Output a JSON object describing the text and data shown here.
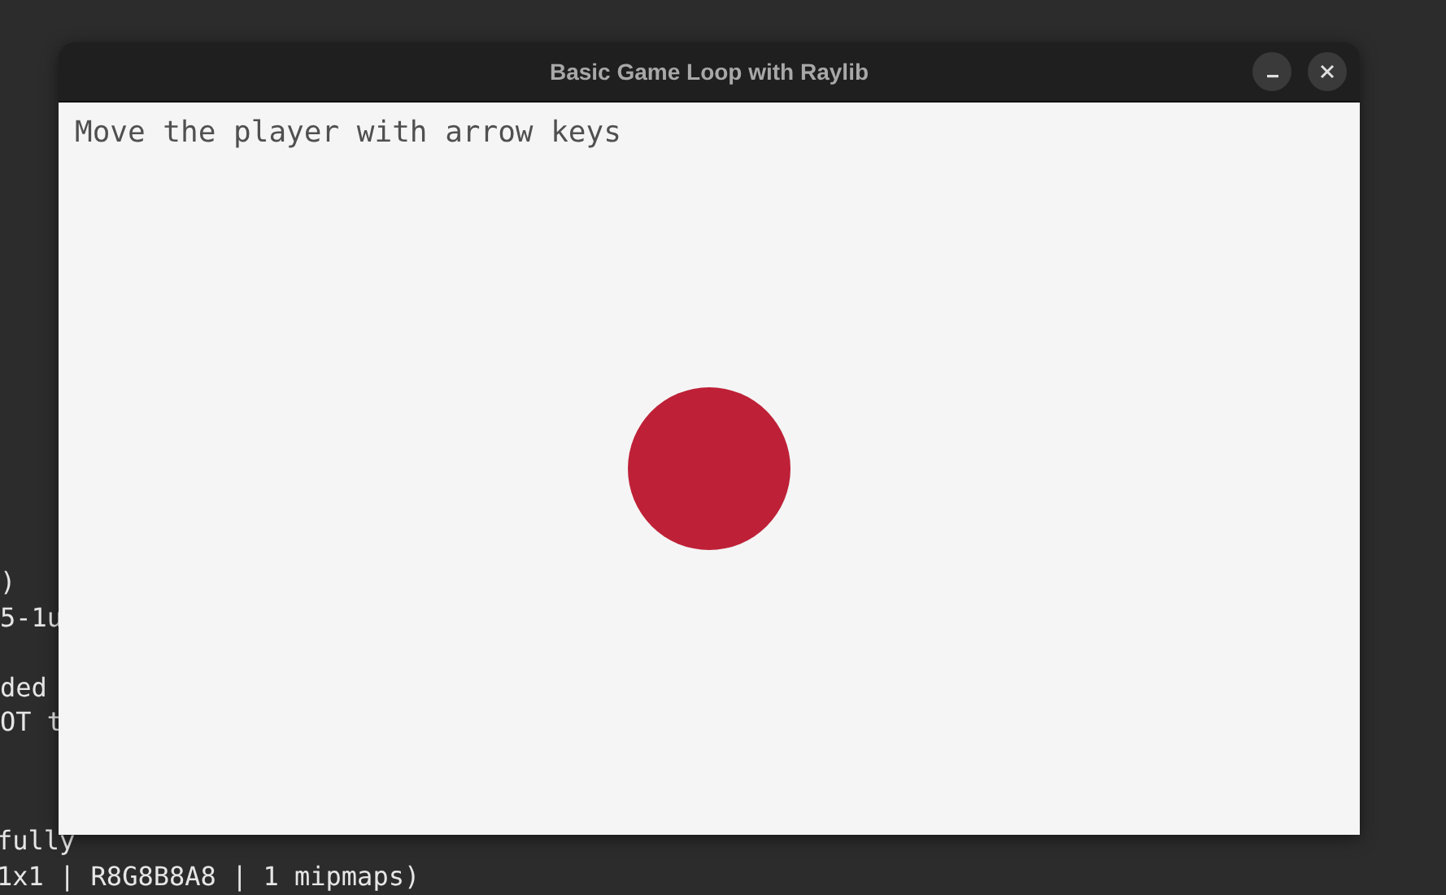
{
  "terminal": {
    "lines_middle": [
      ")",
      "5-1u",
      "ded",
      "OT t"
    ],
    "lines_bottom": [
      "fully",
      "1x1 | R8G8B8A8 | 1 mipmaps)"
    ]
  },
  "window": {
    "title": "Basic Game Loop with Raylib",
    "buttons": [
      {
        "kind": "minimize"
      },
      {
        "kind": "close"
      }
    ]
  },
  "game": {
    "instruction": "Move the player with arrow keys",
    "player": {
      "color": "#be2137"
    }
  }
}
